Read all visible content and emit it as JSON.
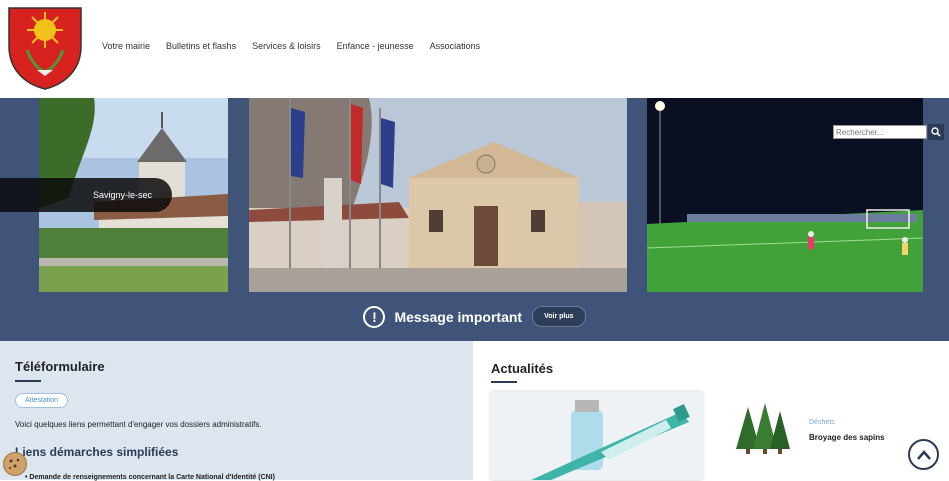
{
  "header": {
    "logo_icon": "coat-of-arms-icon",
    "nav": [
      "Votre mairie",
      "Bulletins et flashs",
      "Services & loisirs",
      "Enfance - jeunesse",
      "Associations"
    ]
  },
  "hero": {
    "town_label": "Savigny-le-sec",
    "search_placeholder": "Rechercher...",
    "search_icon": "search-icon",
    "message_text": "Message important",
    "message_button": "Voir plus",
    "colors": {
      "hero_bg": "#3f5478",
      "accent": "#2c3b55"
    }
  },
  "left": {
    "title": "Téléformulaire",
    "tag": "Attestation",
    "description": "Voici quelques liens permettant d'engager vos dossiers administratifs.",
    "links_title": "Liens démarches simplifiées",
    "links": [
      "Demande de renseignements concernant la Carte National d'Identité (CNI)"
    ]
  },
  "right": {
    "title": "Actualités",
    "news": [
      {
        "category": "Déchets",
        "title": "Broyage des sapins"
      }
    ]
  }
}
